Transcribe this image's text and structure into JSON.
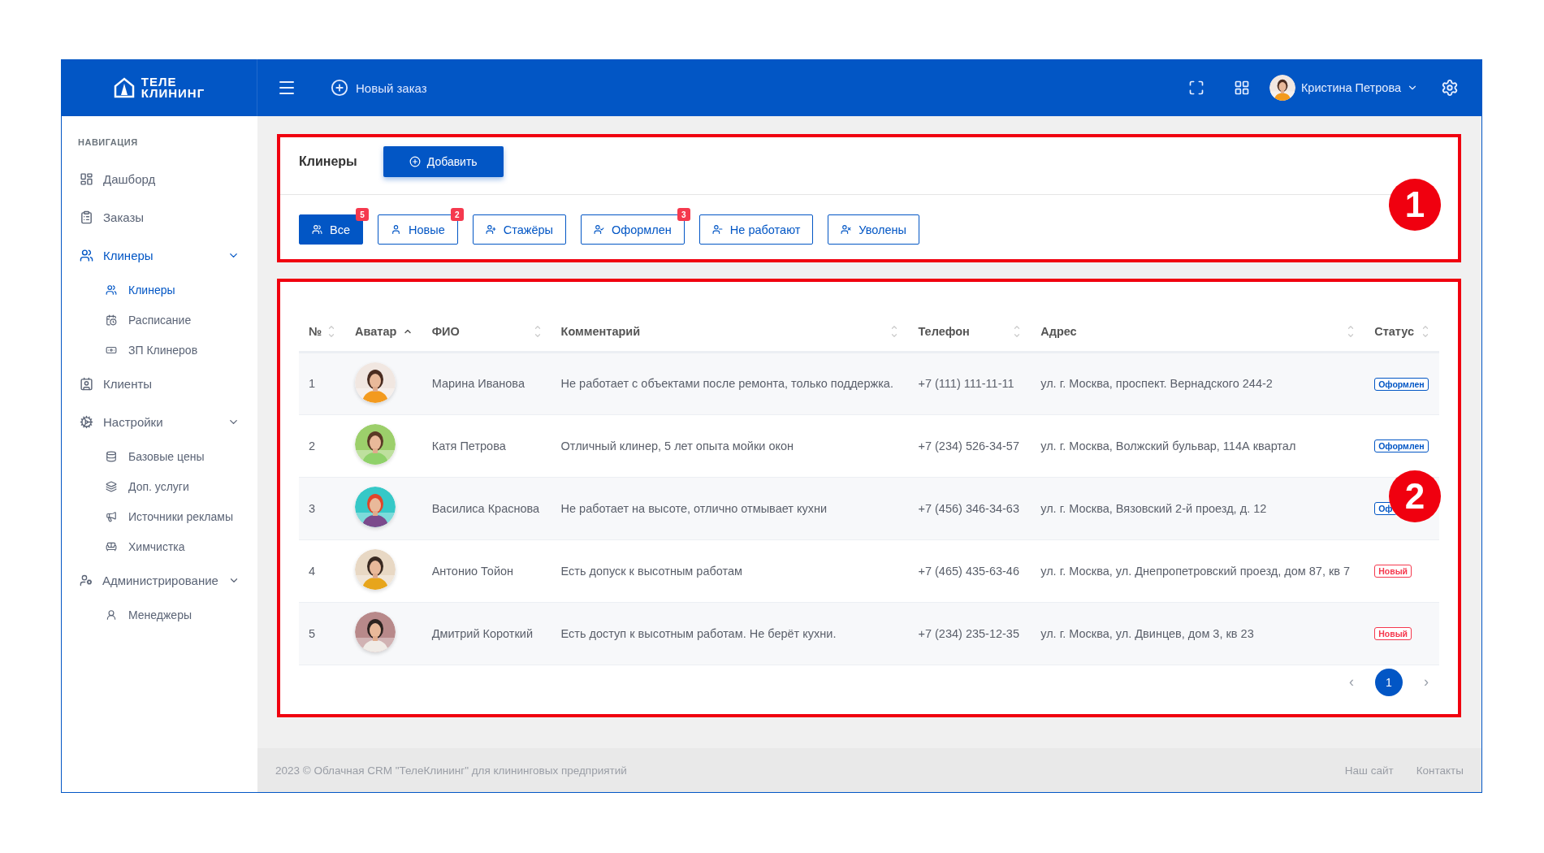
{
  "header": {
    "logo": [
      "ТЕЛЕ",
      "КЛИНИНГ"
    ],
    "new_order": "Новый заказ",
    "user": {
      "name": "Кристина Петрова"
    }
  },
  "sidebar": {
    "heading": "НАВИГАЦИЯ",
    "items": [
      {
        "label": "Дашборд",
        "selected": false
      },
      {
        "label": "Заказы",
        "selected": false
      },
      {
        "label": "Клинеры",
        "selected": true,
        "expanded": true,
        "children": [
          {
            "label": "Клинеры",
            "selected": true
          },
          {
            "label": "Расписание",
            "selected": false
          },
          {
            "label": "ЗП Клинеров",
            "selected": false
          }
        ]
      },
      {
        "label": "Клиенты",
        "selected": false
      },
      {
        "label": "Настройки",
        "selected": false,
        "expanded": true,
        "children": [
          {
            "label": "Базовые цены",
            "selected": false
          },
          {
            "label": "Доп. услуги",
            "selected": false
          },
          {
            "label": "Источники рекламы",
            "selected": false
          },
          {
            "label": "Химчистка",
            "selected": false
          }
        ]
      },
      {
        "label": "Администрирование",
        "selected": false,
        "expanded": true,
        "children": [
          {
            "label": "Менеджеры",
            "selected": false
          }
        ]
      }
    ]
  },
  "filter_card": {
    "annotation": "1",
    "title": "Клинеры",
    "add_button": "Добавить",
    "filters": [
      {
        "label": "Все",
        "selected": true,
        "count": "5"
      },
      {
        "label": "Новые",
        "selected": false,
        "count": "2"
      },
      {
        "label": "Стажёры",
        "selected": false
      },
      {
        "label": "Оформлен",
        "selected": false,
        "count": "3"
      },
      {
        "label": "Не работают",
        "selected": false
      },
      {
        "label": "Уволены",
        "selected": false
      }
    ]
  },
  "table_card": {
    "annotation": "2",
    "table": {
      "columns": [
        {
          "label": "№",
          "sorted": false
        },
        {
          "label": "Аватар",
          "sorted": true
        },
        {
          "label": "ФИО",
          "sorted": false
        },
        {
          "label": "Комментарий",
          "sorted": false
        },
        {
          "label": "Телефон",
          "sorted": false
        },
        {
          "label": "Адрес",
          "sorted": false
        },
        {
          "label": "Статус",
          "sorted": false
        }
      ],
      "rows": [
        {
          "number": "1",
          "name": "Марина Иванова",
          "comment": "Не работает с объектами после ремонта, только поддержка.",
          "phone": "+7 (111) 111-11-11",
          "address": "ул. г. Москва, проспект. Вернадского 244-2",
          "status": {
            "kind": "registered",
            "label": "Оформлен"
          }
        },
        {
          "number": "2",
          "name": "Катя Петрова",
          "comment": "Отличный клинер, 5 лет опыта мойки окон",
          "phone": "+7 (234) 526-34-57",
          "address": "ул. г. Москва, Волжский бульвар, 114А квартал",
          "status": {
            "kind": "registered",
            "label": "Оформлен"
          }
        },
        {
          "number": "3",
          "name": "Василиса Краснова",
          "comment": "Не работает на высоте, отлично отмывает кухни",
          "phone": "+7 (456) 346-34-63",
          "address": "ул. г. Москва, Вязовский 2-й проезд, д. 12",
          "status": {
            "kind": "registered",
            "label": "Оф"
          }
        },
        {
          "number": "4",
          "name": "Антонио Тойон",
          "comment": "Есть допуск к высотным работам",
          "phone": "+7 (465) 435-63-46",
          "address": "ул. г. Москва, ул. Днепропетровский проезд, дом 87, кв 7",
          "status": {
            "kind": "new",
            "label": "Новый"
          }
        },
        {
          "number": "5",
          "name": "Дмитрий Короткий",
          "comment": "Есть доступ к высотным работам. Не берёт кухни.",
          "phone": "+7 (234) 235-12-35",
          "address": "ул. г. Москва, ул. Двинцев, дом 3, кв 23",
          "status": {
            "kind": "new",
            "label": "Новый"
          }
        }
      ]
    },
    "pagination": {
      "prev": "‹",
      "pages": [
        {
          "label": "1",
          "selected": true
        }
      ],
      "next": "›"
    }
  },
  "footer": {
    "copyright": "2023 © Облачная CRM \"ТелеКлининг\" для клининговых предприятий",
    "links": [
      "Наш сайт",
      "Контакты"
    ]
  }
}
